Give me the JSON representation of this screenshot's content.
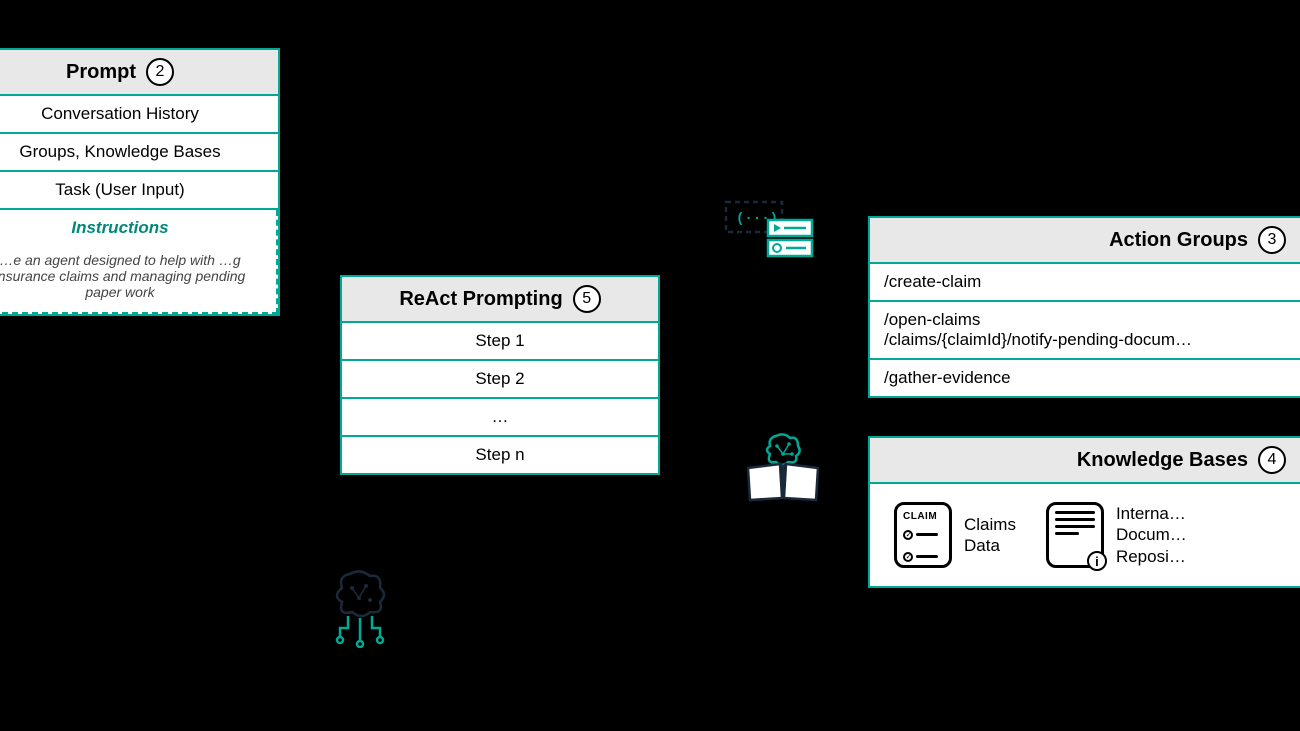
{
  "prompt": {
    "title": "Prompt",
    "badge": "2",
    "rows": [
      "Conversation History",
      "Groups, Knowledge Bases",
      "Task (User Input)"
    ],
    "instructions_label": "Instructions",
    "instructions_body": "…e an agent designed to help with …g insurance claims and managing pending paper work"
  },
  "react": {
    "title": "ReAct Prompting",
    "badge": "5",
    "steps": [
      "Step 1",
      "Step 2",
      "…",
      "Step n"
    ]
  },
  "action_groups": {
    "title": "Action Groups",
    "badge": "3",
    "rows": [
      "/create-claim",
      "/open-claims\n/claims/{claimId}/notify-pending-docum…",
      "/gather-evidence"
    ]
  },
  "knowledge_bases": {
    "title": "Knowledge Bases",
    "badge": "4",
    "items": [
      {
        "icon_text": "CLAIM",
        "label": "Claims\nData"
      },
      {
        "icon_text": "",
        "label": "Interna…\nDocum…\nReposi…"
      }
    ]
  }
}
